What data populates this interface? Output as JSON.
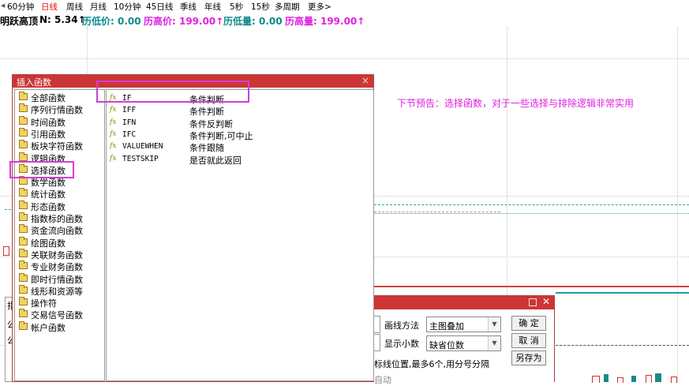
{
  "periods": [
    "60分钟",
    "日线",
    "周线",
    "月线",
    "10分钟",
    "45日线",
    "季线",
    "年线",
    "5秒",
    "15秒",
    "多周期",
    "更多>"
  ],
  "periods_active": "日线",
  "indicator": {
    "name": "明跃高顶",
    "n_label": "N: 5.34↑",
    "low_price": "历低价: 0.00",
    "high_price": "历高价: 199.00↑",
    "low_vol": "历低量: 0.00",
    "high_vol": "历高量: 199.00↑"
  },
  "dialog": {
    "title": "插入函数",
    "close": "×",
    "categories": [
      "全部函数",
      "序列行情函数",
      "时间函数",
      "引用函数",
      "板块字符函数",
      "逻辑函数",
      "选择函数",
      "数学函数",
      "统计函数",
      "形态函数",
      "指数标的函数",
      "资金流向函数",
      "绘图函数",
      "关联财务函数",
      "专业财务函数",
      "即时行情函数",
      "线形和资源等",
      "操作符",
      "交易信号函数",
      "帐户函数"
    ],
    "selected_category": "选择函数",
    "functions": [
      {
        "icon": "fx",
        "name": "IF",
        "desc": "条件判断"
      },
      {
        "icon": "fx",
        "name": "IFF",
        "desc": "条件判断"
      },
      {
        "icon": "fx",
        "name": "IFN",
        "desc": "条件反判断"
      },
      {
        "icon": "fx",
        "name": "IFC",
        "desc": "条件判断,可中止"
      },
      {
        "icon": "fx",
        "name": "VALUEWHEN",
        "desc": "条件跟随"
      },
      {
        "icon": "fx",
        "name": "TESTSKIP",
        "desc": "是否就此返回"
      }
    ],
    "highlighted_function": "IF"
  },
  "note": "下节预告：选择函数，对于一些选择与排除逻辑非常实用",
  "dialog2": {
    "draw_method_label": "画线方法",
    "draw_method_value": "主图叠加",
    "decimals_label": "显示小数",
    "decimals_value": "缺省位数",
    "ok": "确 定",
    "cancel": "取 消",
    "save_as": "另存为",
    "hint": "标线位置,最多6个,用分号分隔",
    "partial": "自动"
  },
  "left_partial": [
    "公",
    "公",
    "指"
  ],
  "colors": {
    "title_bar": "#cc3535",
    "highlight": "#d43dd4",
    "accent_teal": "#0a8a8a",
    "accent_magenta": "#e020e0",
    "active_period": "#e01010"
  }
}
